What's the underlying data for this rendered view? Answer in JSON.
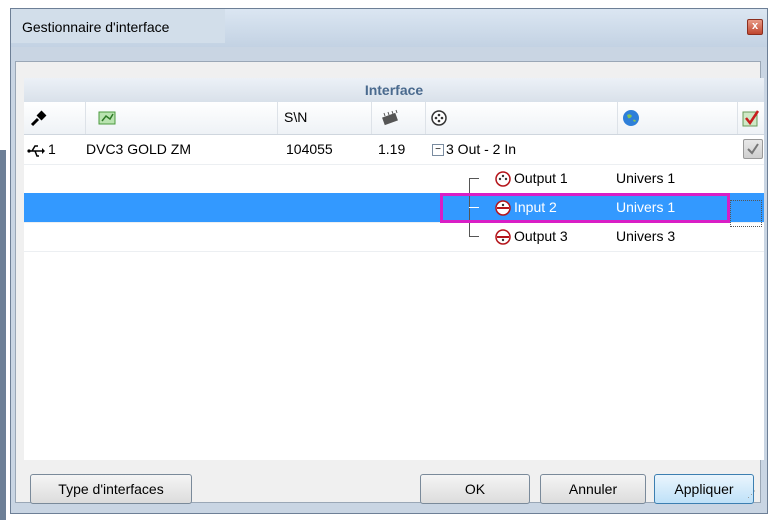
{
  "window": {
    "title": "Gestionnaire d'interface",
    "close_glyph": "x"
  },
  "group_header": "Interface",
  "columns": [
    {
      "icon": "connector-icon",
      "label": ""
    },
    {
      "icon": "card-icon",
      "label": ""
    },
    {
      "icon": "",
      "label": "S\\N"
    },
    {
      "icon": "chip-icon",
      "label": ""
    },
    {
      "icon": "dmx-port-icon",
      "label": ""
    },
    {
      "icon": "globe-icon",
      "label": ""
    },
    {
      "icon": "check-icon",
      "label": ""
    }
  ],
  "device": {
    "index": "1",
    "name": "DVC3 GOLD ZM",
    "serial": "104055",
    "version": "1.19",
    "ports_summary": "3 Out - 2 In",
    "expander": "−"
  },
  "ports": [
    {
      "name": "Output 1",
      "universe": "Univers 1",
      "selected": false
    },
    {
      "name": "Input 2",
      "universe": "Univers 1",
      "selected": true
    },
    {
      "name": "Output 3",
      "universe": "Univers 3",
      "selected": false
    }
  ],
  "buttons": {
    "types": "Type d'interfaces",
    "ok": "OK",
    "cancel": "Annuler",
    "apply": "Appliquer"
  },
  "colors": {
    "selection": "#3399ff",
    "highlight": "#d91ec6",
    "header_text": "#4a6a8e"
  }
}
